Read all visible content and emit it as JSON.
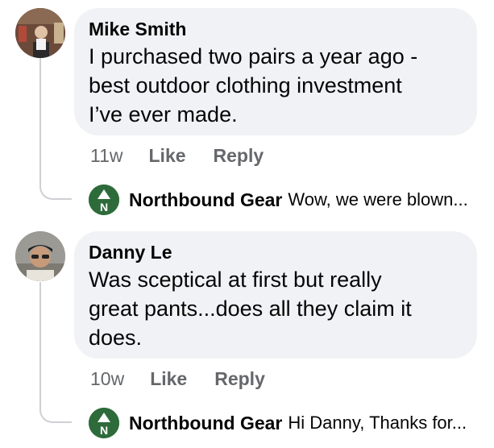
{
  "comments": [
    {
      "author": "Mike Smith",
      "text_lines": [
        "I purchased two pairs a year ago -",
        "best outdoor clothing investment",
        "I’ve ever made."
      ],
      "time": "11w",
      "like_label": "Like",
      "reply_label": "Reply",
      "avatar_icon": "user-avatar-photo",
      "reply": {
        "author": "Northbound Gear",
        "snippet": "Wow, we were blown...",
        "icon": "northbound-gear-logo-icon",
        "logo_letter": "N"
      }
    },
    {
      "author": "Danny Le",
      "text_lines": [
        "Was sceptical at first but really",
        "great pants...does all they claim it",
        "does."
      ],
      "time": "10w",
      "like_label": "Like",
      "reply_label": "Reply",
      "avatar_icon": "user-avatar-photo",
      "reply": {
        "author": "Northbound Gear",
        "snippet": "Hi Danny, Thanks for...",
        "icon": "northbound-gear-logo-icon",
        "logo_letter": "N"
      }
    }
  ],
  "colors": {
    "bubble": "#f0f2f5",
    "meta": "#65676b",
    "brand_green": "#2e6b3a",
    "thread_line": "#ced0d4"
  }
}
